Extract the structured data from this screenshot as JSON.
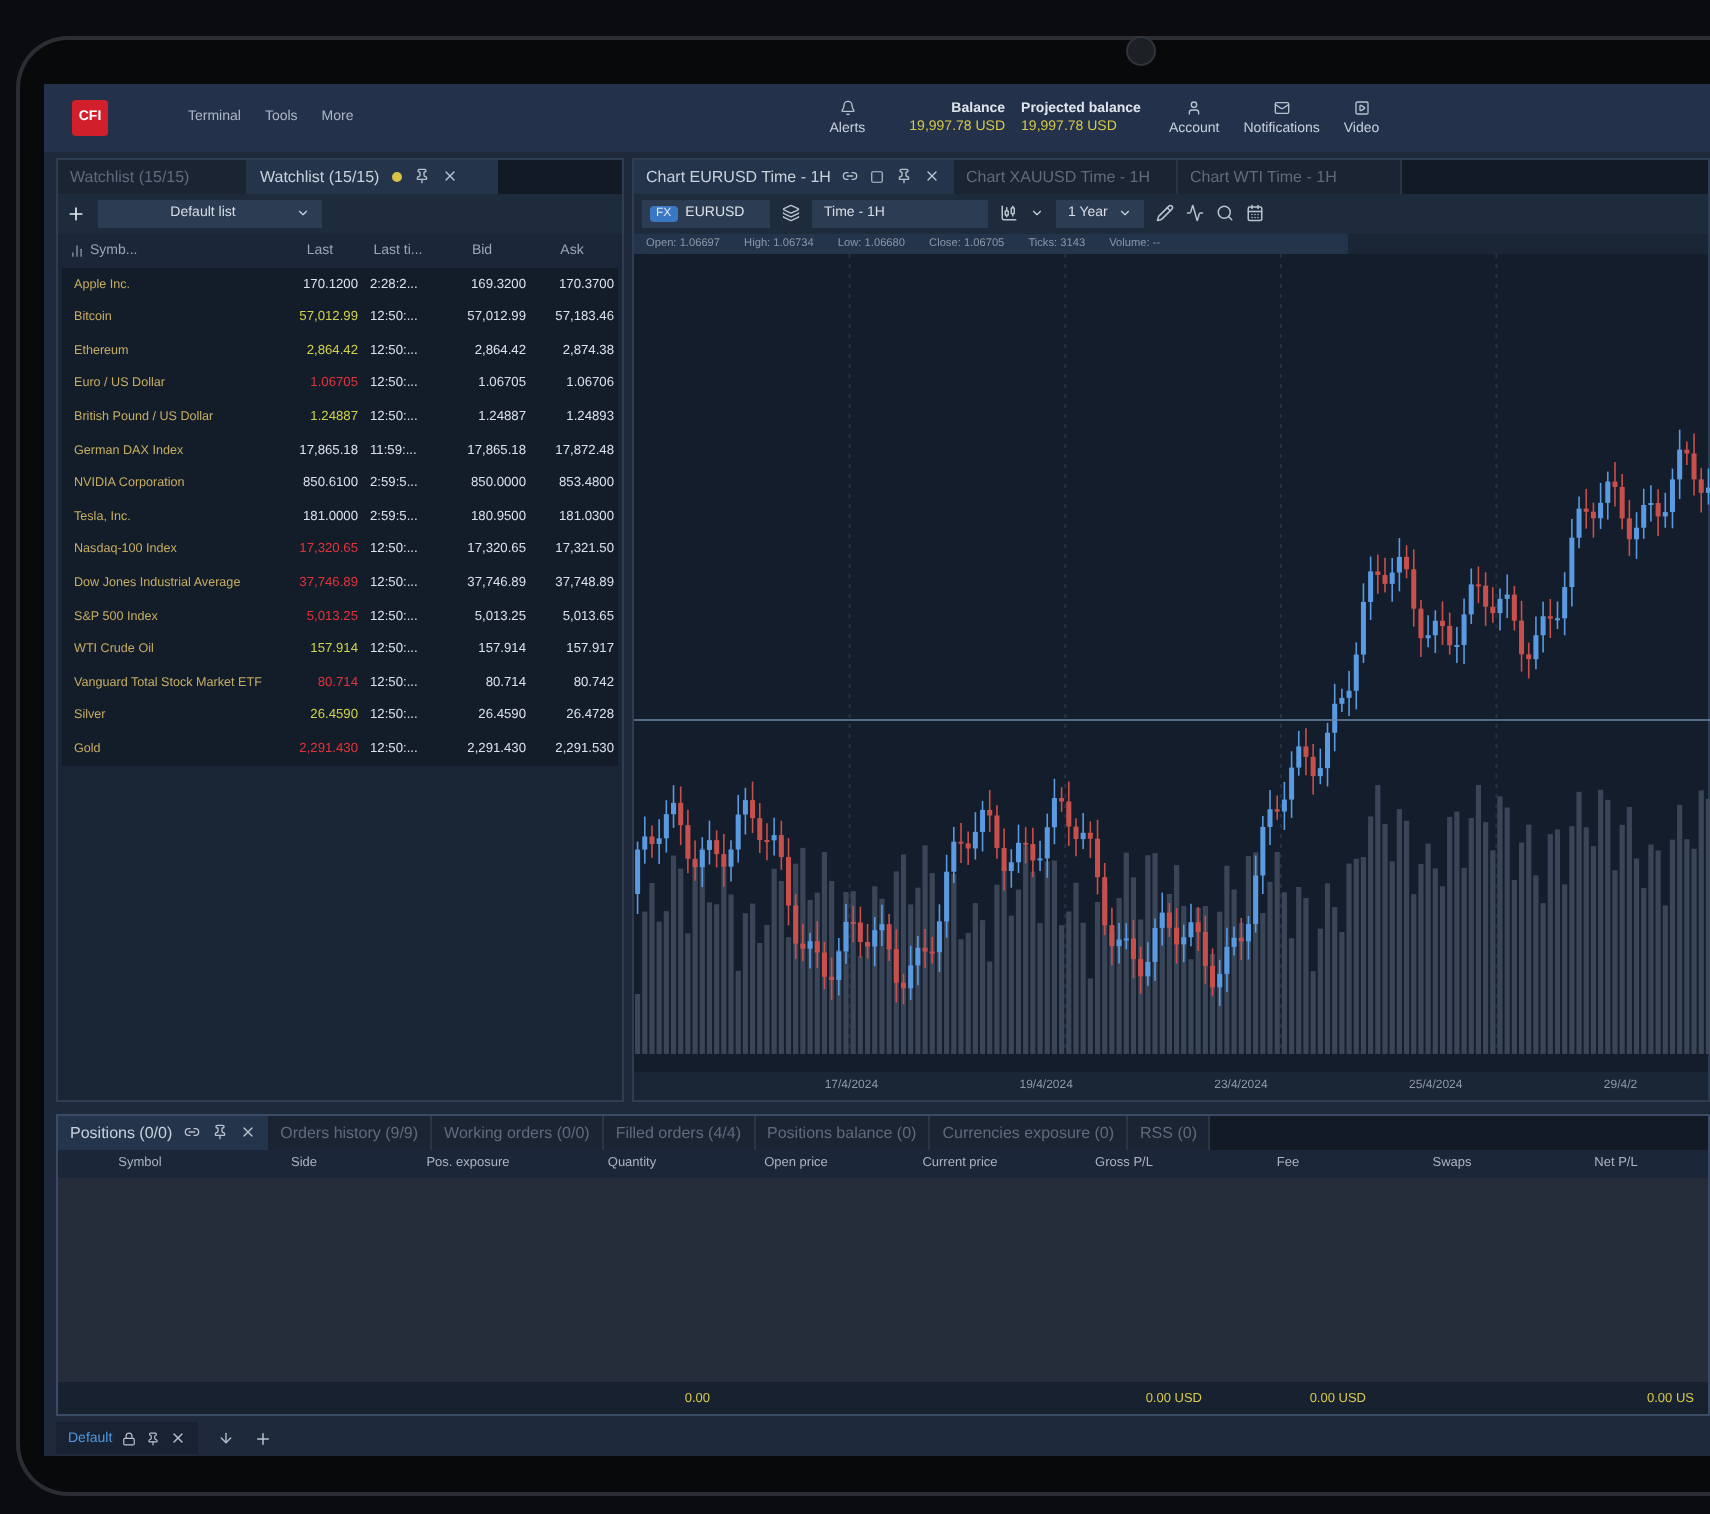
{
  "topbar": {
    "logo": "CFI",
    "menu": [
      "Terminal",
      "Tools",
      "More"
    ],
    "alerts": "Alerts",
    "balance": {
      "label": "Balance",
      "value": "19,997.78 USD"
    },
    "projected_balance": {
      "label": "Projected balance",
      "value": "19,997.78 USD"
    },
    "actions": [
      {
        "kind": "account",
        "label": "Account"
      },
      {
        "kind": "notifications",
        "label": "Notifications"
      },
      {
        "kind": "video",
        "label": "Video"
      }
    ]
  },
  "watchlist": {
    "tabs": [
      {
        "label": "Watchlist (15/15)",
        "selected": false
      },
      {
        "label": "Watchlist (15/15)",
        "selected": true
      }
    ],
    "list": "Default list",
    "columns": [
      "Symb...",
      "Last",
      "Last ti...",
      "Bid",
      "Ask"
    ],
    "rows": [
      {
        "symbol": "Apple Inc.",
        "last": "170.1200",
        "color": "#dbe1ea",
        "time": "2:28:2...",
        "bid": "169.3200",
        "ask": "170.3700"
      },
      {
        "symbol": "Bitcoin",
        "last": "57,012.99",
        "color": "#cfd24a",
        "time": "12:50:...",
        "bid": "57,012.99",
        "ask": "57,183.46"
      },
      {
        "symbol": "Ethereum",
        "last": "2,864.42",
        "color": "#cfd24a",
        "time": "12:50:...",
        "bid": "2,864.42",
        "ask": "2,874.38"
      },
      {
        "symbol": "Euro / US Dollar",
        "last": "1.06705",
        "color": "#e0343a",
        "time": "12:50:...",
        "bid": "1.06705",
        "ask": "1.06706"
      },
      {
        "symbol": "British Pound / US Dollar",
        "last": "1.24887",
        "color": "#cfd24a",
        "time": "12:50:...",
        "bid": "1.24887",
        "ask": "1.24893"
      },
      {
        "symbol": "German DAX Index",
        "last": "17,865.18",
        "color": "#dbe1ea",
        "time": "11:59:...",
        "bid": "17,865.18",
        "ask": "17,872.48"
      },
      {
        "symbol": "NVIDIA Corporation",
        "last": "850.6100",
        "color": "#dbe1ea",
        "time": "2:59:5...",
        "bid": "850.0000",
        "ask": "853.4800"
      },
      {
        "symbol": "Tesla, Inc.",
        "last": "181.0000",
        "color": "#dbe1ea",
        "time": "2:59:5...",
        "bid": "180.9500",
        "ask": "181.0300"
      },
      {
        "symbol": "Nasdaq-100 Index",
        "last": "17,320.65",
        "color": "#e0343a",
        "time": "12:50:...",
        "bid": "17,320.65",
        "ask": "17,321.50"
      },
      {
        "symbol": "Dow Jones Industrial Average",
        "last": "37,746.89",
        "color": "#e0343a",
        "time": "12:50:...",
        "bid": "37,746.89",
        "ask": "37,748.89"
      },
      {
        "symbol": "S&P 500 Index",
        "last": "5,013.25",
        "color": "#e0343a",
        "time": "12:50:...",
        "bid": "5,013.25",
        "ask": "5,013.65"
      },
      {
        "symbol": "WTI Crude Oil",
        "last": "157.914",
        "color": "#cfd24a",
        "time": "12:50:...",
        "bid": "157.914",
        "ask": "157.917"
      },
      {
        "symbol": "Vanguard Total Stock Market ETF",
        "last": "80.714",
        "color": "#e0343a",
        "time": "12:50:...",
        "bid": "80.714",
        "ask": "80.742"
      },
      {
        "symbol": "Silver",
        "last": "26.4590",
        "color": "#cfd24a",
        "time": "12:50:...",
        "bid": "26.4590",
        "ask": "26.4728"
      },
      {
        "symbol": "Gold",
        "last": "2,291.430",
        "color": "#e0343a",
        "time": "12:50:...",
        "bid": "2,291.430",
        "ask": "2,291.530"
      }
    ]
  },
  "chart": {
    "tabs": [
      {
        "label": "Chart EURUSD Time - 1H",
        "selected": true
      },
      {
        "label": "Chart XAUUSD Time - 1H",
        "selected": false
      },
      {
        "label": "Chart WTI Time - 1H",
        "selected": false
      }
    ],
    "market": "FX",
    "symbol": "EURUSD",
    "timeframe": "Time - 1H",
    "range": "1 Year",
    "info": [
      {
        "label": "Open:",
        "value": "1.06697"
      },
      {
        "label": "High:",
        "value": "1.06734"
      },
      {
        "label": "Low:",
        "value": "1.06680"
      },
      {
        "label": "Close:",
        "value": "1.06705"
      },
      {
        "label": "Ticks:",
        "value": "3143"
      },
      {
        "label": "Volume:",
        "value": "--"
      }
    ],
    "dates": [
      "17/4/2024",
      "19/4/2024",
      "23/4/2024",
      "25/4/2024",
      "29/4/2"
    ]
  },
  "positions": {
    "tabs": [
      {
        "label": "Positions (0/0)",
        "selected": true
      },
      {
        "label": "Orders history (9/9)",
        "selected": false
      },
      {
        "label": "Working orders (0/0)",
        "selected": false
      },
      {
        "label": "Filled orders (4/4)",
        "selected": false
      },
      {
        "label": "Positions balance (0)",
        "selected": false
      },
      {
        "label": "Currencies exposure (0)",
        "selected": false
      },
      {
        "label": "RSS (0)",
        "selected": false
      }
    ],
    "columns": [
      {
        "label": "Symbol"
      },
      {
        "label": "Side"
      },
      {
        "label": "Pos. exposure"
      },
      {
        "label": "Quantity",
        "total": "0.00"
      },
      {
        "label": "Open price"
      },
      {
        "label": "Current price"
      },
      {
        "label": "Gross P/L",
        "total": "0.00 USD"
      },
      {
        "label": "Fee",
        "total": "0.00 USD"
      },
      {
        "label": "Swaps"
      },
      {
        "label": "Net P/L",
        "total": "0.00 US"
      }
    ]
  },
  "workspace": {
    "tab": "Default"
  }
}
